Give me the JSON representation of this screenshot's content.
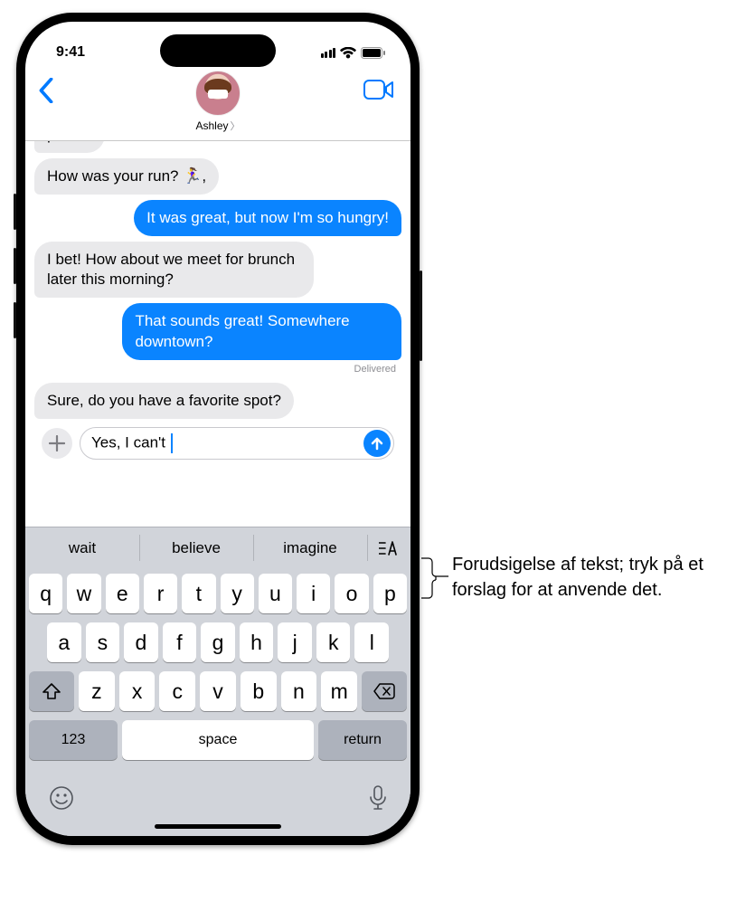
{
  "status": {
    "time": "9:41"
  },
  "header": {
    "contact_name": "Ashley"
  },
  "messages": {
    "m0": "plaza?",
    "m1": "How was your run? 🏃‍♀️,",
    "m2": "It was great, but now I'm so hungry!",
    "m3": "I bet! How about we meet for brunch later this morning?",
    "m4": "That sounds great! Somewhere downtown?",
    "m5": "Sure, do you have a favorite spot?",
    "delivered": "Delivered"
  },
  "compose": {
    "text": "Yes, I can't "
  },
  "predictions": {
    "p0": "wait",
    "p1": "believe",
    "p2": "imagine"
  },
  "keyboard": {
    "row1": [
      "q",
      "w",
      "e",
      "r",
      "t",
      "y",
      "u",
      "i",
      "o",
      "p"
    ],
    "row2": [
      "a",
      "s",
      "d",
      "f",
      "g",
      "h",
      "j",
      "k",
      "l"
    ],
    "row3": [
      "z",
      "x",
      "c",
      "v",
      "b",
      "n",
      "m"
    ],
    "num": "123",
    "space": "space",
    "return": "return"
  },
  "callout": {
    "text": "Forudsigelse af tekst; tryk på et forslag for at anvende det."
  }
}
